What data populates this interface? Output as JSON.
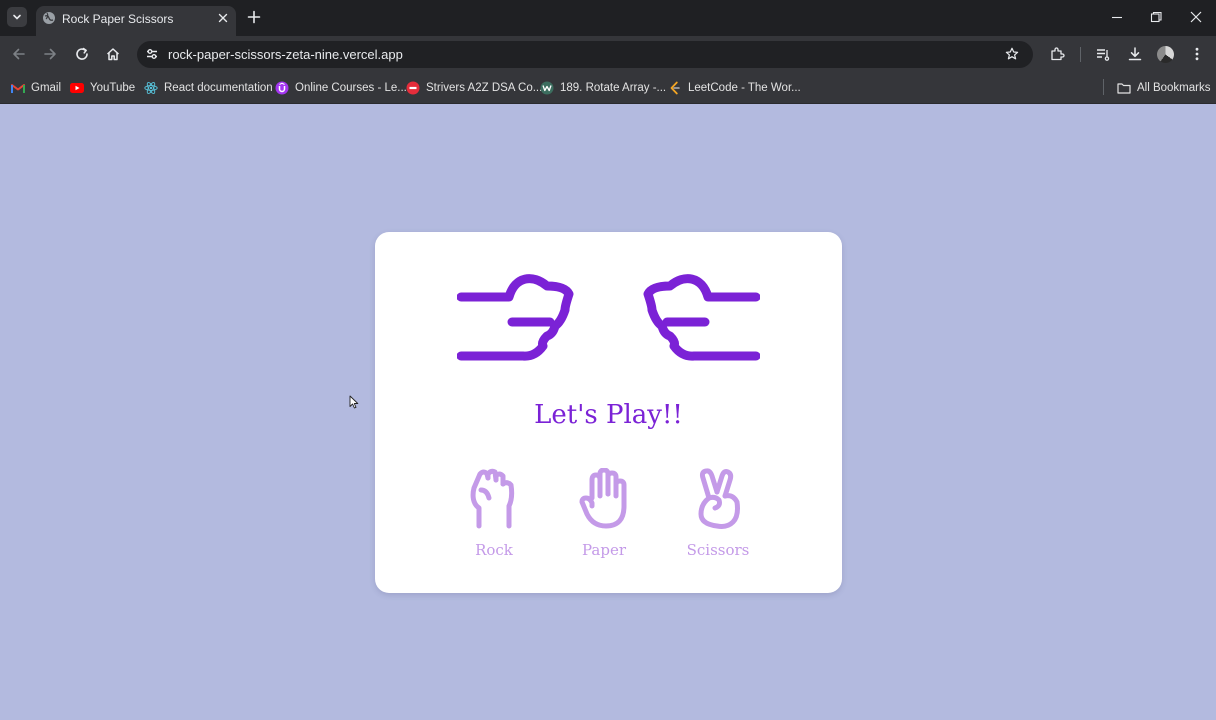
{
  "browser": {
    "tab_title": "Rock Paper Scissors",
    "url": "rock-paper-scissors-zeta-nine.vercel.app",
    "bookmarks": [
      {
        "label": "Gmail",
        "icon": "gmail-icon"
      },
      {
        "label": "YouTube",
        "icon": "youtube-icon"
      },
      {
        "label": "React documentation",
        "icon": "react-icon"
      },
      {
        "label": "Online Courses - Le...",
        "icon": "udemy-icon"
      },
      {
        "label": "Strivers A2Z DSA Co...",
        "icon": "striver-icon"
      },
      {
        "label": "189. Rotate Array -...",
        "icon": "leetcode-w-icon"
      },
      {
        "label": "LeetCode - The Wor...",
        "icon": "leetcode-icon"
      }
    ],
    "all_bookmarks_label": "All Bookmarks"
  },
  "game": {
    "status": "Let's Play!!",
    "choices": [
      {
        "label": "Rock",
        "icon": "rock-fist-icon"
      },
      {
        "label": "Paper",
        "icon": "paper-hand-icon"
      },
      {
        "label": "Scissors",
        "icon": "scissors-hand-icon"
      }
    ]
  },
  "colors": {
    "page_background": "#b3badf",
    "card_background": "#ffffff",
    "accent_purple": "#7b22d6",
    "choice_lavender": "#c49ae8",
    "chrome_dark": "#35363a"
  }
}
